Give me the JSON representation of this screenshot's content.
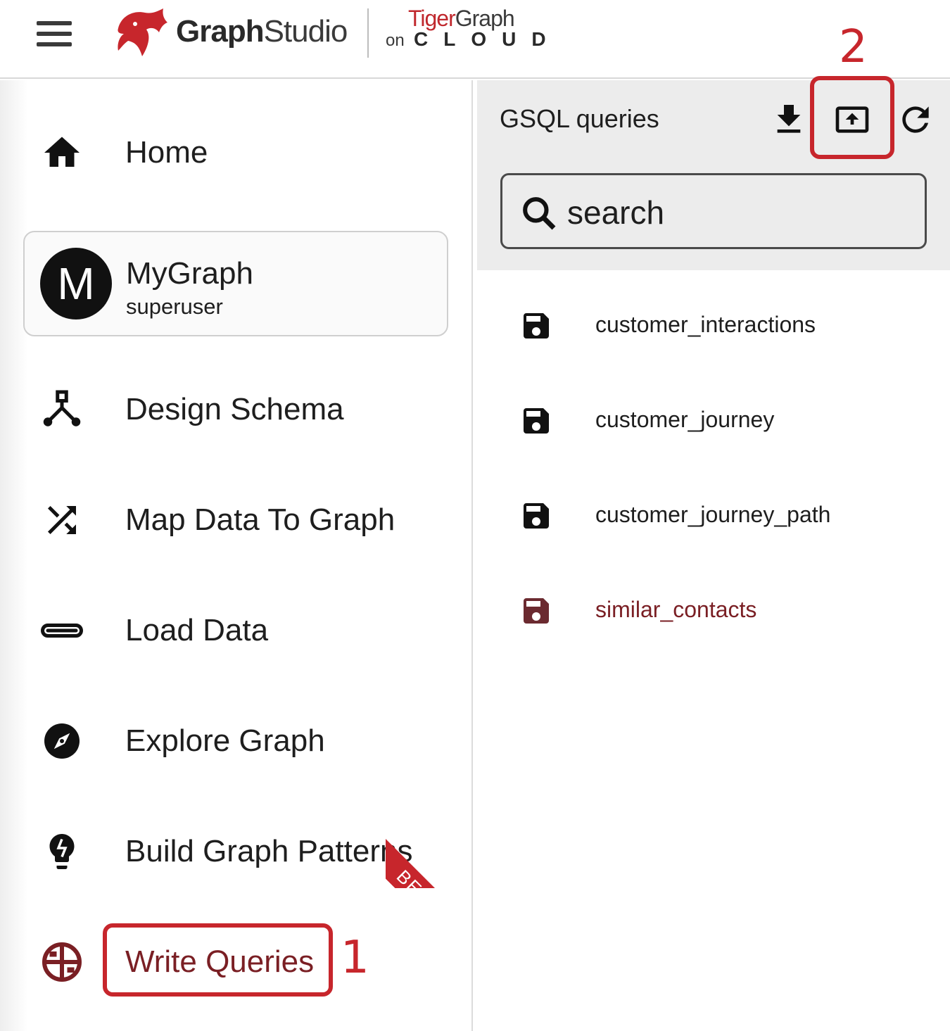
{
  "header": {
    "app_name_bold": "Graph",
    "app_name_rest": "Studio",
    "brand_tiger": "Tiger",
    "brand_graph": "Graph",
    "brand_on": "on",
    "brand_cloud": "CLOUD"
  },
  "sidebar": {
    "home_label": "Home",
    "graph": {
      "avatar_letter": "M",
      "name": "MyGraph",
      "role": "superuser"
    },
    "items": [
      {
        "label": "Design Schema",
        "icon": "schema-icon"
      },
      {
        "label": "Map Data To Graph",
        "icon": "shuffle-icon"
      },
      {
        "label": "Load Data",
        "icon": "progress-bar-icon"
      },
      {
        "label": "Explore Graph",
        "icon": "compass-icon"
      },
      {
        "label": "Build Graph Patterns",
        "icon": "lightbulb-icon"
      },
      {
        "label": "Write Queries",
        "icon": "queries-icon",
        "active": true
      }
    ],
    "beta_badge": "BETA"
  },
  "panel": {
    "title": "GSQL queries",
    "search_placeholder": "search",
    "queries": [
      {
        "name": "customer_interactions"
      },
      {
        "name": "customer_journey"
      },
      {
        "name": "customer_journey_path"
      },
      {
        "name": "similar_contacts",
        "active": true
      }
    ]
  },
  "annotations": {
    "step1": "1",
    "step2": "2"
  },
  "colors": {
    "accent": "#c7262c",
    "active_text": "#7a1f24",
    "text": "#1e1e1e",
    "panel_bg": "#ececec"
  }
}
